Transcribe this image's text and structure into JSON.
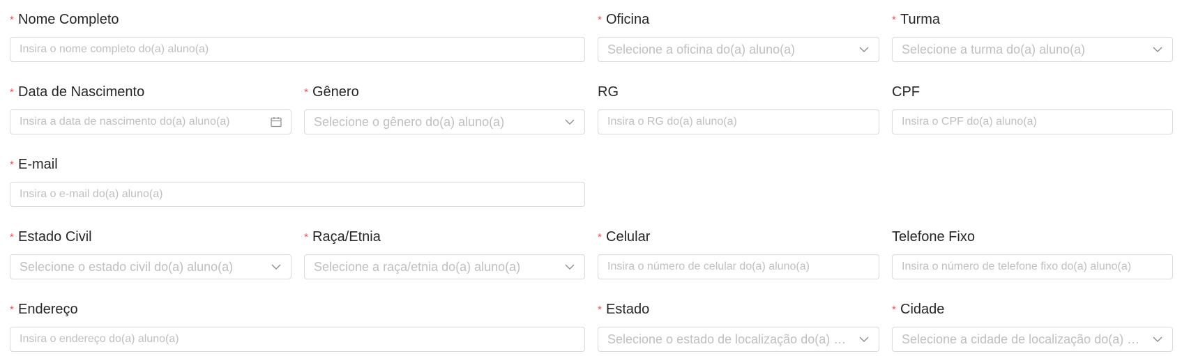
{
  "fields": {
    "nome": {
      "label": "Nome Completo",
      "required": "*",
      "placeholder": "Insira o nome completo do(a) aluno(a)"
    },
    "oficina": {
      "label": "Oficina",
      "required": "*",
      "placeholder": "Selecione a oficina do(a) aluno(a)"
    },
    "turma": {
      "label": "Turma",
      "required": "*",
      "placeholder": "Selecione a turma do(a) aluno(a)"
    },
    "nascimento": {
      "label": "Data de Nascimento",
      "required": "*",
      "placeholder": "Insira a data de nascimento do(a) aluno(a)"
    },
    "genero": {
      "label": "Gênero",
      "required": "*",
      "placeholder": "Selecione o gênero do(a) aluno(a)"
    },
    "rg": {
      "label": "RG",
      "placeholder": "Insira o RG do(a) aluno(a)"
    },
    "cpf": {
      "label": "CPF",
      "placeholder": "Insira o CPF do(a) aluno(a)"
    },
    "email": {
      "label": "E-mail",
      "required": "*",
      "placeholder": "Insira o e-mail do(a) aluno(a)"
    },
    "estado_civil": {
      "label": "Estado Civil",
      "required": "*",
      "placeholder": "Selecione o estado civil do(a) aluno(a)"
    },
    "raca": {
      "label": "Raça/Etnia",
      "required": "*",
      "placeholder": "Selecione a raça/etnia do(a) aluno(a)"
    },
    "celular": {
      "label": "Celular",
      "required": "*",
      "placeholder": "Insira o número de celular do(a) aluno(a)"
    },
    "telefone": {
      "label": "Telefone Fixo",
      "placeholder": "Insira o número de telefone fixo do(a) aluno(a)"
    },
    "endereco": {
      "label": "Endereço",
      "required": "*",
      "placeholder": "Insira o endereço do(a) aluno(a)"
    },
    "estado": {
      "label": "Estado",
      "required": "*",
      "placeholder": "Selecione o estado de localização do(a) al…"
    },
    "cidade": {
      "label": "Cidade",
      "required": "*",
      "placeholder": "Selecione a cidade de localização do(a) al…"
    }
  },
  "icons": {
    "select": "chevron-down-icon",
    "date": "calendar-icon"
  },
  "colors": {
    "required_marker": "#ff4d4f",
    "label": "#262626",
    "placeholder": "#bfbfbf",
    "border": "#d9d9d9"
  }
}
